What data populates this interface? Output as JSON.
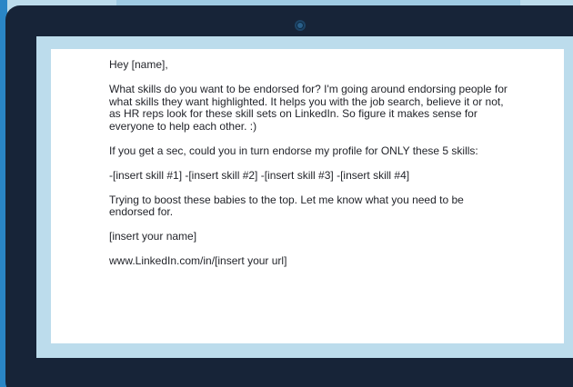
{
  "email": {
    "greeting": "Hey [name],",
    "paragraph_1": "What skills do you want to be endorsed for? I'm going around endorsing people for what skills they want highlighted. It helps you with the job search, believe it or not, as HR reps look for these skill sets on LinkedIn. So figure it makes sense for everyone to help each other. :)",
    "paragraph_2": "If you get a sec, could you in turn endorse my profile for ONLY these 5 skills:",
    "skills_line": "-[insert skill #1] -[insert skill #2] -[insert skill #3] -[insert skill #4]",
    "paragraph_3": "Trying to boost these babies to the top. Let me know what you need to be endorsed for.",
    "signature": "[insert your name]",
    "profile_url": "www.LinkedIn.com/in/[insert your url]"
  },
  "icons": {
    "camera": "webcam-icon"
  },
  "colors": {
    "bezel": "#172438",
    "screen_background": "#bcdcec",
    "document": "#ffffff",
    "accent_edge": "#2a86c6",
    "text": "#23252b"
  }
}
